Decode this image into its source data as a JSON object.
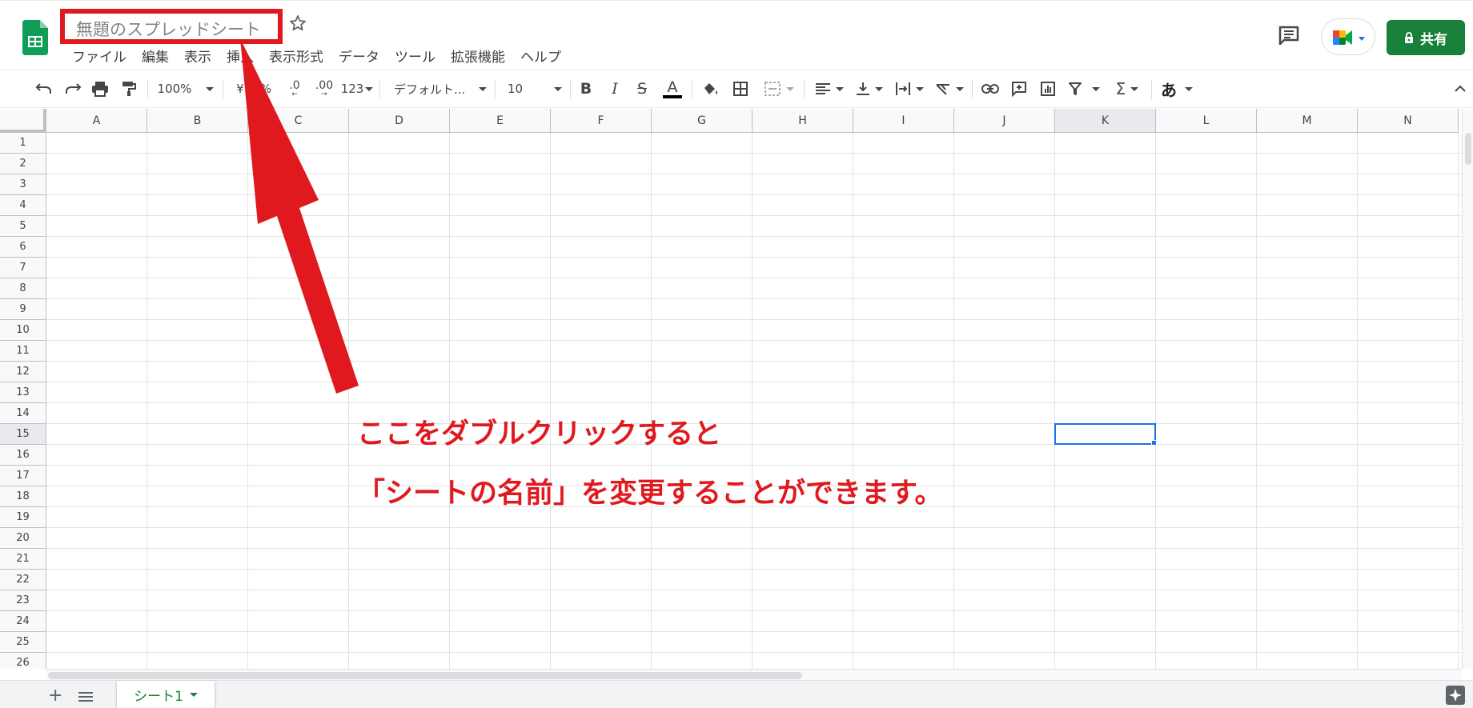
{
  "document": {
    "title": "無題のスプレッドシート"
  },
  "menu": [
    "ファイル",
    "編集",
    "表示",
    "挿入",
    "表示形式",
    "データ",
    "ツール",
    "拡張機能",
    "ヘルプ"
  ],
  "header": {
    "share_label": "共有",
    "comment_icon": "comment-icon",
    "meet_icon": "google-meet-icon"
  },
  "toolbar": {
    "zoom": "100%",
    "currency": "¥",
    "percent": "%",
    "decimal_decrease": ".0",
    "decimal_increase": ".00",
    "number_format": "123",
    "font": "デフォルト...",
    "font_size": "10",
    "bold": "B",
    "italic": "I",
    "strikethrough": "S",
    "text_color": "A",
    "input_tools": "あ",
    "functions": "Σ"
  },
  "grid": {
    "columns": [
      "A",
      "B",
      "C",
      "D",
      "E",
      "F",
      "G",
      "H",
      "I",
      "J",
      "K",
      "L",
      "M",
      "N"
    ],
    "rows": [
      "1",
      "2",
      "3",
      "4",
      "5",
      "6",
      "7",
      "8",
      "9",
      "10",
      "11",
      "12",
      "13",
      "14",
      "15",
      "16",
      "17",
      "18",
      "19",
      "20",
      "21",
      "22",
      "23",
      "24",
      "25",
      "26"
    ],
    "selected_column": "K",
    "selected_row": "15"
  },
  "sheets": {
    "tabs": [
      "シート1"
    ]
  },
  "annotation": {
    "line1": "ここをダブルクリックすると",
    "line2": "「シートの名前」を変更することができます。"
  },
  "colors": {
    "brand_green": "#188038",
    "annotation_red": "#e0191f",
    "selection_blue": "#1a73e8"
  }
}
